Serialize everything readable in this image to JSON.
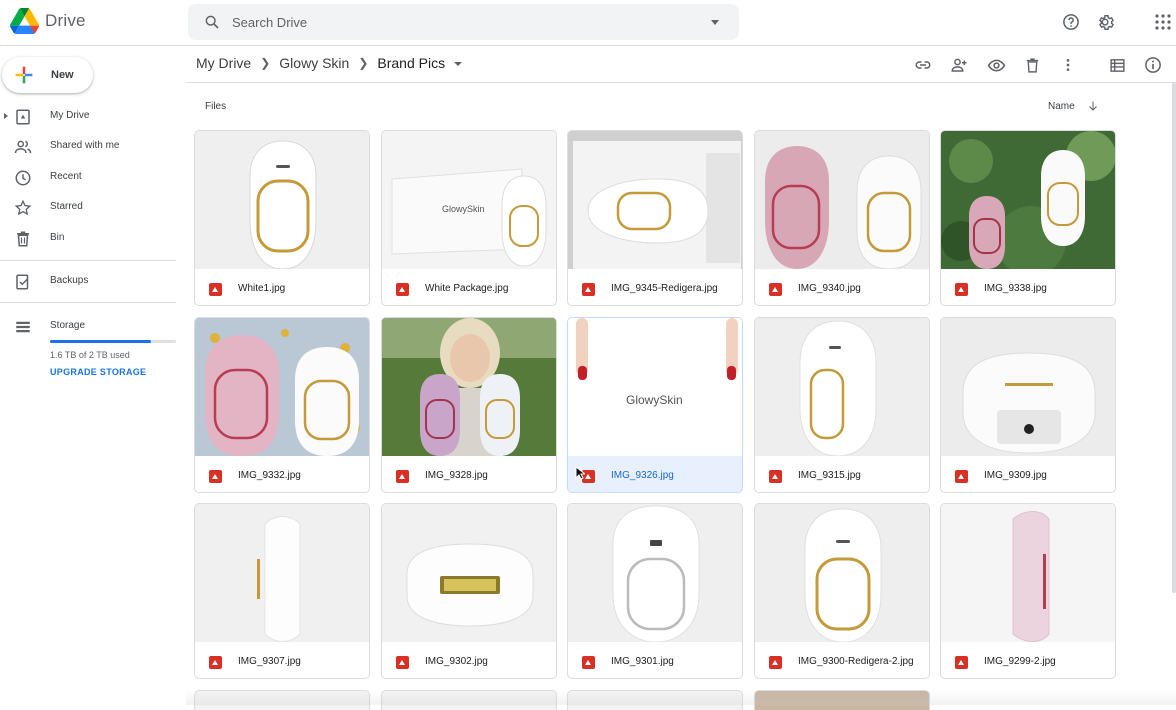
{
  "app": {
    "name": "Drive"
  },
  "search": {
    "placeholder": "Search Drive"
  },
  "sidebar": {
    "new_label": "New",
    "items": [
      {
        "label": "My Drive"
      },
      {
        "label": "Shared with me"
      },
      {
        "label": "Recent"
      },
      {
        "label": "Starred"
      },
      {
        "label": "Bin"
      },
      {
        "label": "Backups"
      },
      {
        "label": "Storage"
      }
    ],
    "storage_used": "1.6 TB of 2 TB used",
    "storage_fraction": 0.8,
    "upgrade_label": "UPGRADE STORAGE"
  },
  "breadcrumb": {
    "items": [
      "My Drive",
      "Glowy Skin",
      "Brand Pics"
    ]
  },
  "toolbar": {
    "icons": [
      "link-icon",
      "share-icon",
      "preview-icon",
      "trash-icon",
      "more-icon",
      "list-view-icon",
      "info-icon"
    ]
  },
  "files_label": "Files",
  "sort_label": "Name",
  "files": [
    {
      "name": "White1.jpg"
    },
    {
      "name": "White Package.jpg",
      "brand": "GlowySkin"
    },
    {
      "name": "IMG_9345-Redigera.jpg"
    },
    {
      "name": "IMG_9340.jpg"
    },
    {
      "name": "IMG_9338.jpg"
    },
    {
      "name": "IMG_9332.jpg"
    },
    {
      "name": "IMG_9328.jpg"
    },
    {
      "name": "IMG_9326.jpg",
      "brand": "GlowySkin",
      "selected": true
    },
    {
      "name": "IMG_9315.jpg"
    },
    {
      "name": "IMG_9309.jpg"
    },
    {
      "name": "IMG_9307.jpg"
    },
    {
      "name": "IMG_9302.jpg"
    },
    {
      "name": "IMG_9301.jpg"
    },
    {
      "name": "IMG_9300-Redigera-2.jpg"
    },
    {
      "name": "IMG_9299-2.jpg"
    }
  ],
  "colors": {
    "accent": "#1a73e8",
    "image_icon": "#d93025",
    "selected_bg": "#e8f0fe"
  }
}
